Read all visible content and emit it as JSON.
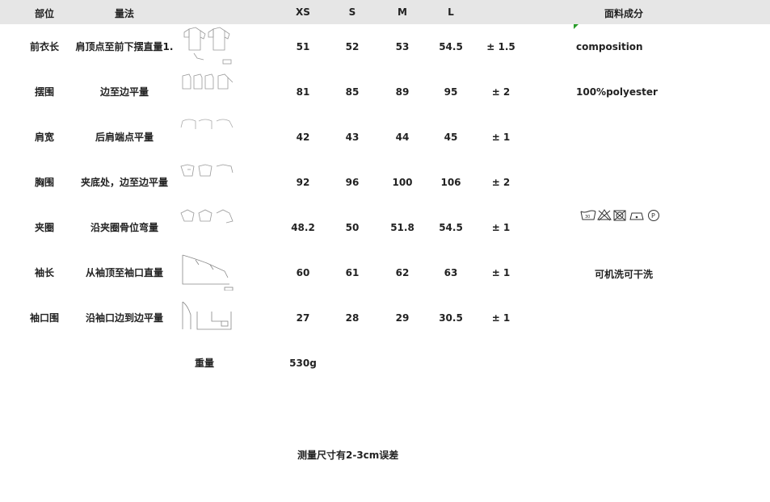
{
  "header": {
    "part": "部位",
    "method": "量法",
    "xs": "XS",
    "s": "S",
    "m": "M",
    "l": "L",
    "material": "面料成分"
  },
  "rows": [
    {
      "part": "前衣长",
      "method": "肩顶点至前下摆直量1.",
      "xs": "51",
      "s": "52",
      "m": "53",
      "l": "54.5",
      "tol": "± 1.5",
      "thumb": "front-length-sketch-icon"
    },
    {
      "part": "摆围",
      "method": "边至边平量",
      "xs": "81",
      "s": "85",
      "m": "89",
      "l": "95",
      "tol": "± 2",
      "thumb": "hem-sketch-icon"
    },
    {
      "part": "肩宽",
      "method": "后肩端点平量",
      "xs": "42",
      "s": "43",
      "m": "44",
      "l": "45",
      "tol": "± 1",
      "thumb": "shoulder-sketch-icon"
    },
    {
      "part": "胸围",
      "method": "夹底处，边至边平量",
      "xs": "92",
      "s": "96",
      "m": "100",
      "l": "106",
      "tol": "± 2",
      "thumb": "chest-sketch-icon"
    },
    {
      "part": "夹圈",
      "method": "沿夹圈骨位弯量",
      "xs": "48.2",
      "s": "50",
      "m": "51.8",
      "l": "54.5",
      "tol": "± 1",
      "thumb": "armhole-sketch-icon"
    },
    {
      "part": "袖长",
      "method": "从袖顶至袖口直量",
      "xs": "60",
      "s": "61",
      "m": "62",
      "l": "63",
      "tol": "± 1",
      "thumb": "sleeve-length-sketch-icon"
    },
    {
      "part": "袖口围",
      "method": "沿袖口边到边平量",
      "xs": "27",
      "s": "28",
      "m": "29",
      "l": "30.5",
      "tol": "± 1",
      "thumb": "cuff-sketch-icon"
    }
  ],
  "weight": {
    "label": "重量",
    "value": "530g"
  },
  "material": {
    "line1": "composition",
    "line2": "100%polyester",
    "care_note": "可机洗可干洗"
  },
  "care_icons": [
    "wash-30-icon",
    "no-bleach-icon",
    "no-tumble-dry-icon",
    "iron-low-icon",
    "dry-clean-p-icon"
  ],
  "footnote": "测量尺寸有2-3cm误差",
  "colors": {
    "header_bg": "#e6e6e6",
    "text": "#222222",
    "corner_mark": "#2a9d2a"
  }
}
